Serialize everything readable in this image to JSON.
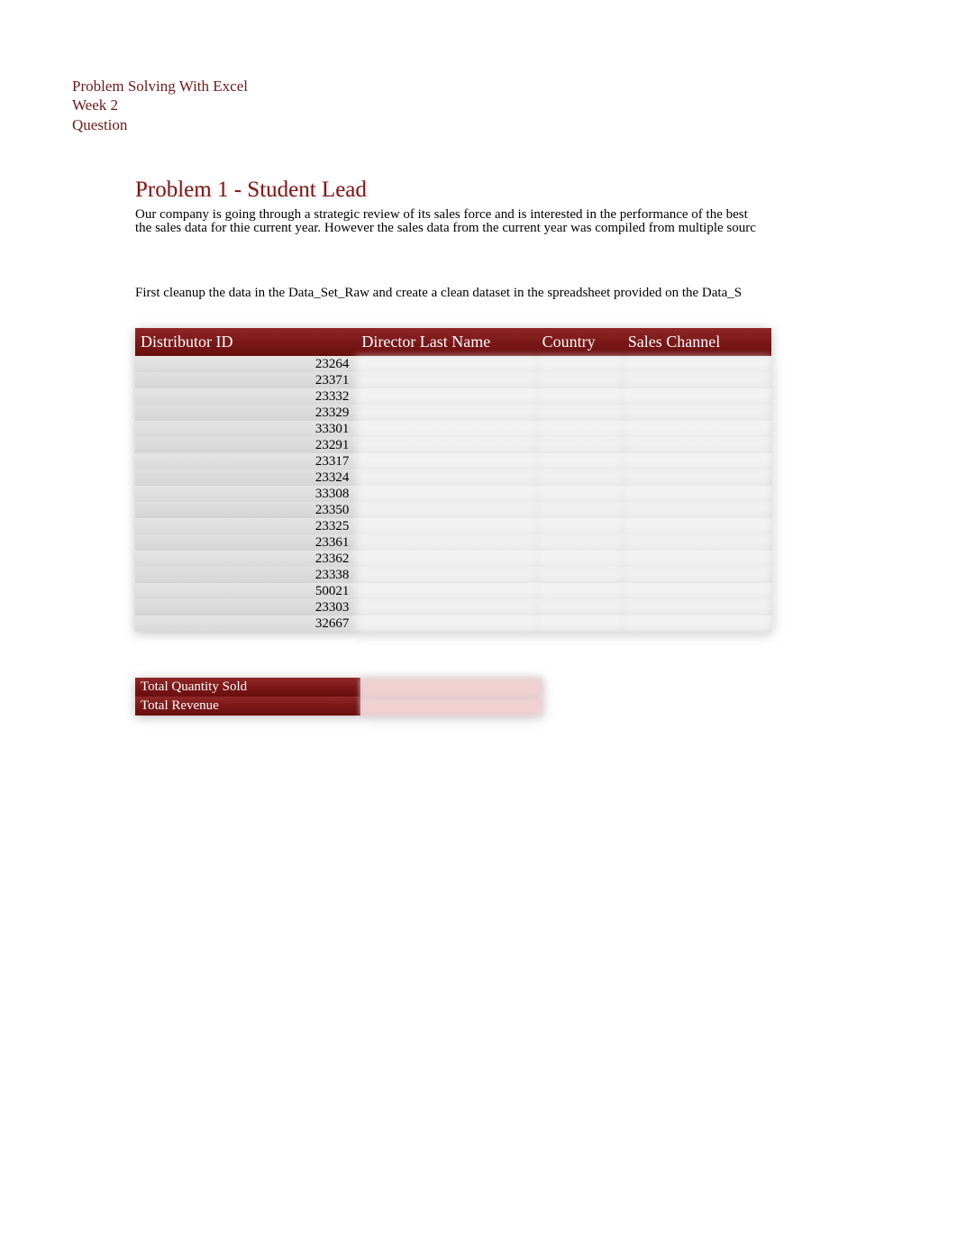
{
  "header": {
    "course": "Problem Solving With Excel",
    "week": "Week 2",
    "label": "Question"
  },
  "content": {
    "title": "Problem 1 - Student Lead",
    "description_line1": "Our company is going through a strategic review of its sales force and is interested in the performance of the best",
    "description_line2": "the sales data for thie current year. However the sales data from the current year was compiled from multiple sourc",
    "instruction": "First cleanup the data in the Data_Set_Raw and create a clean dataset in the spreadsheet provided on the Data_S"
  },
  "table": {
    "headers": {
      "distributor_id": "Distributor ID",
      "director_last_name": "Director Last Name",
      "country": "Country",
      "sales_channel": "Sales Channel"
    },
    "rows": [
      {
        "id": "23264"
      },
      {
        "id": "23371"
      },
      {
        "id": "23332"
      },
      {
        "id": "23329"
      },
      {
        "id": "33301"
      },
      {
        "id": "23291"
      },
      {
        "id": "23317"
      },
      {
        "id": "23324"
      },
      {
        "id": "33308"
      },
      {
        "id": "23350"
      },
      {
        "id": "23325"
      },
      {
        "id": "23361"
      },
      {
        "id": "23362"
      },
      {
        "id": "23338"
      },
      {
        "id": "50021"
      },
      {
        "id": "23303"
      },
      {
        "id": "32667"
      }
    ]
  },
  "summary": {
    "total_quantity_sold_label": "Total Quantity Sold",
    "total_revenue_label": "Total Revenue"
  }
}
